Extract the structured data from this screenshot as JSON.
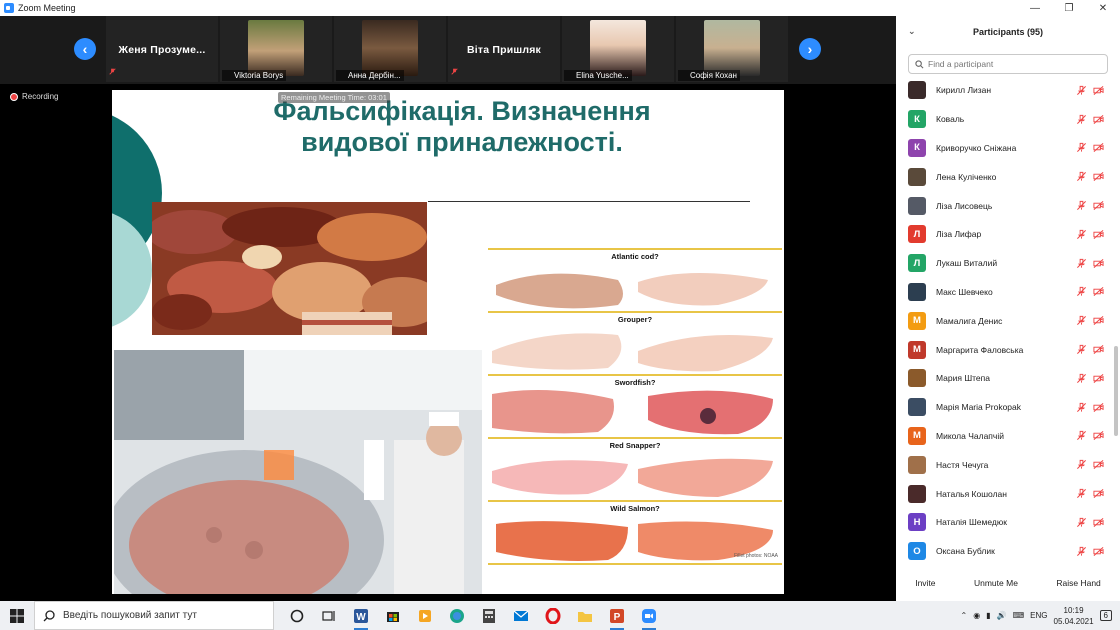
{
  "window": {
    "title": "Zoom Meeting"
  },
  "gallery": {
    "tiles": [
      {
        "name": "Женя  Прозуме..."
      },
      {
        "label": "Viktoria  Borys"
      },
      {
        "label": "Анна Дербін..."
      },
      {
        "name": "Віта Пришляк"
      },
      {
        "label": "Elina Yusche..."
      },
      {
        "label": "Софія Кохан"
      }
    ]
  },
  "recording": {
    "label": "Recording"
  },
  "remaining": {
    "label": "Remaining Meeting Time: 03:01"
  },
  "slide": {
    "title_line1": "Фальсифікація. Визначення",
    "title_line2": "видової приналежності.",
    "fish_rows": [
      "Atlantic cod?",
      "Grouper?",
      "Swordfish?",
      "Red Snapper?",
      "Wild Salmon?"
    ],
    "credit": "Fillet photos: NOAA"
  },
  "participants": {
    "header": "Participants (95)",
    "search_placeholder": "Find a participant",
    "items": [
      {
        "name": "Кирилл Лизан",
        "avatar_color": "#3a2a2a",
        "initial": ""
      },
      {
        "name": "Коваль",
        "avatar_color": "#23a566",
        "initial": "К"
      },
      {
        "name": "Криворучко Сніжана",
        "avatar_color": "#8e44ad",
        "initial": "К"
      },
      {
        "name": "Лена Куліченко",
        "avatar_color": "#5a4a3a",
        "initial": ""
      },
      {
        "name": "Ліза Лисовець",
        "avatar_color": "#555a66",
        "initial": ""
      },
      {
        "name": "Ліза Лифар",
        "avatar_color": "#e23b2e",
        "initial": "Л"
      },
      {
        "name": "Лукаш Виталий",
        "avatar_color": "#23a566",
        "initial": "Л"
      },
      {
        "name": "Макс Шевчеко",
        "avatar_color": "#2c3e50",
        "initial": ""
      },
      {
        "name": "Мамалига Денис",
        "avatar_color": "#f39c12",
        "initial": "М"
      },
      {
        "name": "Маргарита Фаловська",
        "avatar_color": "#c0392b",
        "initial": "М"
      },
      {
        "name": "Мария Штепа",
        "avatar_color": "#8b5a2b",
        "initial": ""
      },
      {
        "name": "Марія Maria Prokopak",
        "avatar_color": "#3b4d63",
        "initial": ""
      },
      {
        "name": "Микола Чалапчій",
        "avatar_color": "#e8641b",
        "initial": "М"
      },
      {
        "name": "Настя Чечуга",
        "avatar_color": "#a0704a",
        "initial": ""
      },
      {
        "name": "Наталья Кошолан",
        "avatar_color": "#4a2a2a",
        "initial": ""
      },
      {
        "name": "Наталія Шемедюк",
        "avatar_color": "#6c3fc4",
        "initial": "Н"
      },
      {
        "name": "Оксана Бублик",
        "avatar_color": "#1e88e5",
        "initial": "О"
      }
    ],
    "actions": {
      "invite": "Invite",
      "unmute": "Unmute Me",
      "raise_hand": "Raise Hand"
    }
  },
  "taskbar": {
    "search_placeholder": "Введіть пошуковий запит тут",
    "lang": "ENG",
    "time": "10:19",
    "date": "05.04.2021",
    "notif_count": "6"
  }
}
